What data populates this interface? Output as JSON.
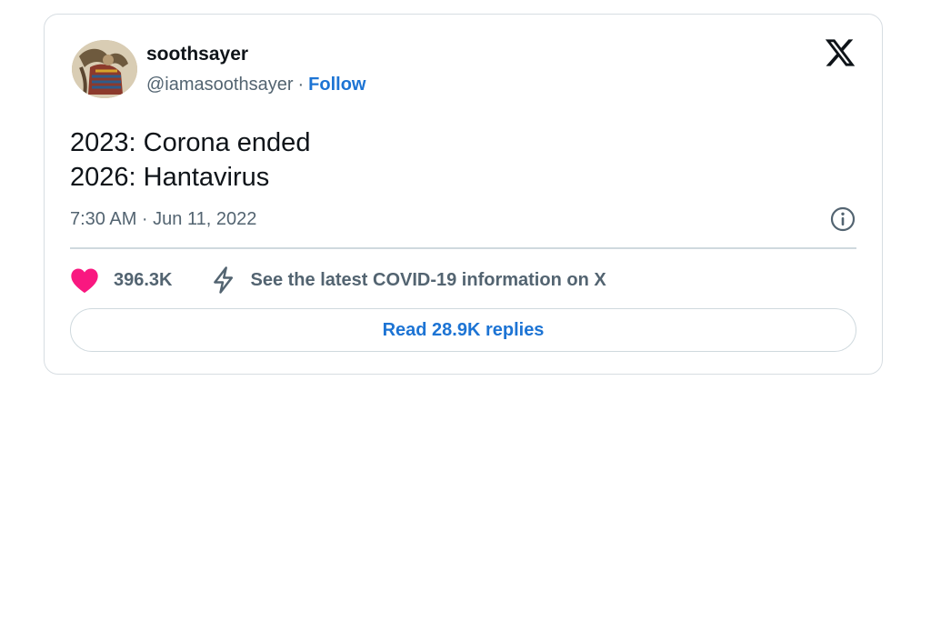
{
  "tweet": {
    "author": {
      "display_name": "soothsayer",
      "handle": "@iamasoothsayer",
      "separator": "·",
      "follow_label": "Follow"
    },
    "text_lines": [
      "2023: Corona ended",
      "2026: Hantavirus"
    ],
    "timestamp": "7:30 AM · Jun 11, 2022",
    "likes": "396.3K",
    "covid_info": "See the latest COVID-19 information on X",
    "read_replies_label": "Read 28.9K replies"
  },
  "icons": {
    "logo": "x-logo-icon",
    "info": "info-icon",
    "like": "heart-icon",
    "covid": "lightning-bolt-icon"
  },
  "colors": {
    "link": "#1d74d4",
    "heart": "#f91880",
    "text_primary": "#0f1419",
    "text_secondary": "#536471",
    "border": "#cfd9de"
  }
}
